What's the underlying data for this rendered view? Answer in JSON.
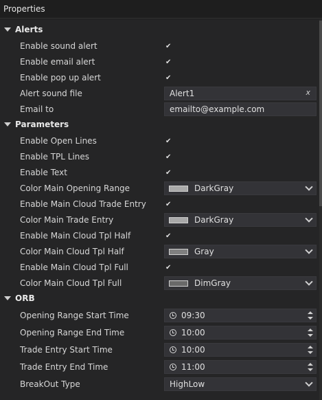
{
  "window": {
    "title": "Properties"
  },
  "sections": {
    "alerts": "Alerts",
    "parameters": "Parameters",
    "orb": "ORB"
  },
  "alerts": {
    "enable_sound_alert": {
      "label": "Enable sound alert",
      "checked": true
    },
    "enable_email_alert": {
      "label": "Enable email alert",
      "checked": true
    },
    "enable_popup_alert": {
      "label": "Enable pop up alert",
      "checked": true
    },
    "alert_sound_file": {
      "label": "Alert sound file",
      "value": "Alert1",
      "clear": "x"
    },
    "email_to": {
      "label": "Email to",
      "value": "emailto@example.com"
    }
  },
  "parameters": {
    "enable_open_lines": {
      "label": "Enable Open Lines",
      "checked": true
    },
    "enable_tpl_lines": {
      "label": "Enable TPL Lines",
      "checked": true
    },
    "enable_text": {
      "label": "Enable Text",
      "checked": true
    },
    "color_main_opening_range": {
      "label": "Color Main Opening Range",
      "value": "DarkGray",
      "color": "#a9a9a9"
    },
    "enable_main_cloud_trade_entry": {
      "label": "Enable Main Cloud Trade Entry",
      "checked": true
    },
    "color_main_trade_entry": {
      "label": "Color Main Trade Entry",
      "value": "DarkGray",
      "color": "#a9a9a9"
    },
    "enable_main_cloud_tpl_half": {
      "label": "Enable Main Cloud Tpl Half",
      "checked": true
    },
    "color_main_cloud_tpl_half": {
      "label": "Color Main Cloud Tpl Half",
      "value": "Gray",
      "color": "#808080"
    },
    "enable_main_cloud_tpl_full": {
      "label": "Enable Main Cloud Tpl Full",
      "checked": true
    },
    "color_main_cloud_tpl_full": {
      "label": "Color Main Cloud Tpl Full",
      "value": "DimGray",
      "color": "#696969"
    }
  },
  "orb": {
    "opening_range_start_time": {
      "label": "Opening Range Start Time",
      "value": "09:30"
    },
    "opening_range_end_time": {
      "label": "Opening Range End Time",
      "value": "10:00"
    },
    "trade_entry_start_time": {
      "label": "Trade Entry Start Time",
      "value": "10:00"
    },
    "trade_entry_end_time": {
      "label": "Trade Entry End Time",
      "value": "11:00"
    },
    "breakout_type": {
      "label": "BreakOut Type",
      "value": "HighLow"
    }
  },
  "glyphs": {
    "check": "✔"
  },
  "icons": {
    "section_toggle": "chevron-down-icon",
    "time": "clock-icon",
    "dropdown": "chevron-down-icon",
    "spinner": "spinner-arrows-icon"
  }
}
